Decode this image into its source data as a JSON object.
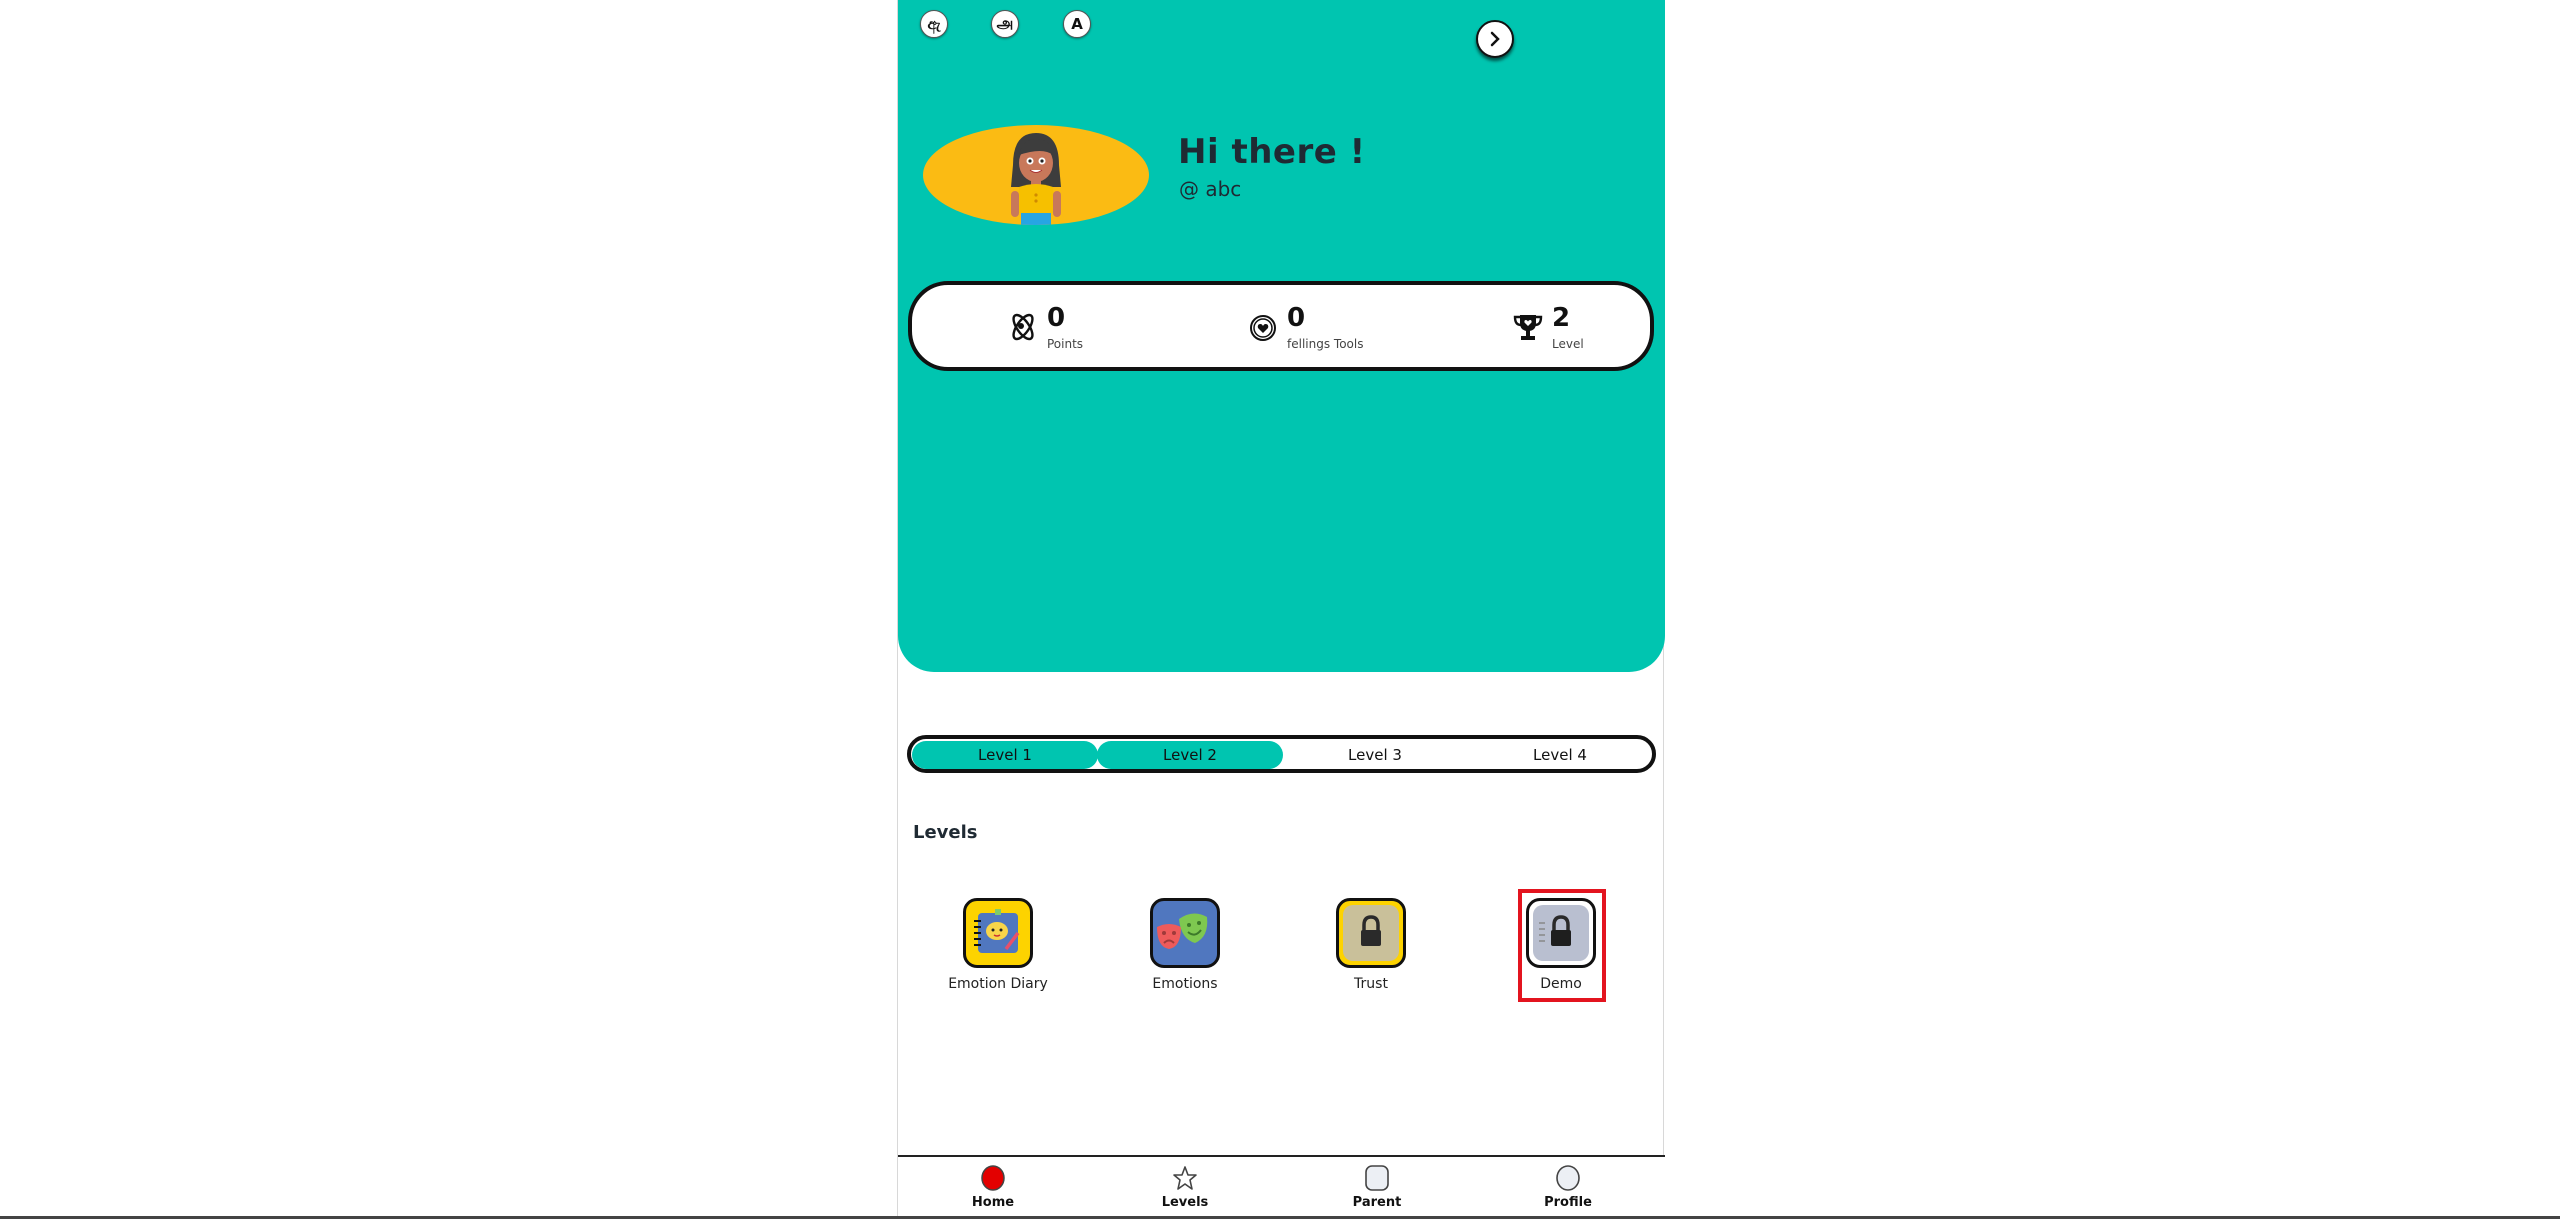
{
  "header": {
    "languages": [
      {
        "label": "ඇ",
        "name": "sinhala"
      },
      {
        "label": "அ",
        "name": "tamil"
      },
      {
        "label": "A",
        "name": "english"
      }
    ],
    "greeting": "Hi there !",
    "username": "@ abc"
  },
  "stats": [
    {
      "value": "0",
      "label": "Points",
      "icon": "atom-icon"
    },
    {
      "value": "0",
      "label": "fellings Tools",
      "icon": "heart-badge-icon"
    },
    {
      "value": "2",
      "label": "Level",
      "icon": "trophy-icon"
    }
  ],
  "level_progress": {
    "levels": [
      "Level 1",
      "Level 2",
      "Level 3",
      "Level 4"
    ],
    "completed": 2
  },
  "levels_section": {
    "title": "Levels",
    "items": [
      {
        "label": "Emotion Diary",
        "locked": false,
        "color": "#fdd300"
      },
      {
        "label": "Emotions",
        "locked": false,
        "color": "#5077bf"
      },
      {
        "label": "Trust",
        "locked": true,
        "color": "#fdd300"
      },
      {
        "label": "Demo",
        "locked": true,
        "color": "#b9bfd0"
      }
    ]
  },
  "nav": {
    "items": [
      {
        "label": "Home",
        "active": true
      },
      {
        "label": "Levels",
        "active": false
      },
      {
        "label": "Parent",
        "active": false
      },
      {
        "label": "Profile",
        "active": false
      }
    ]
  },
  "colors": {
    "primary": "#00c5b0",
    "avatar_bg": "#fbbb13",
    "active_nav": "#e30000",
    "highlight": "#e3141f"
  }
}
